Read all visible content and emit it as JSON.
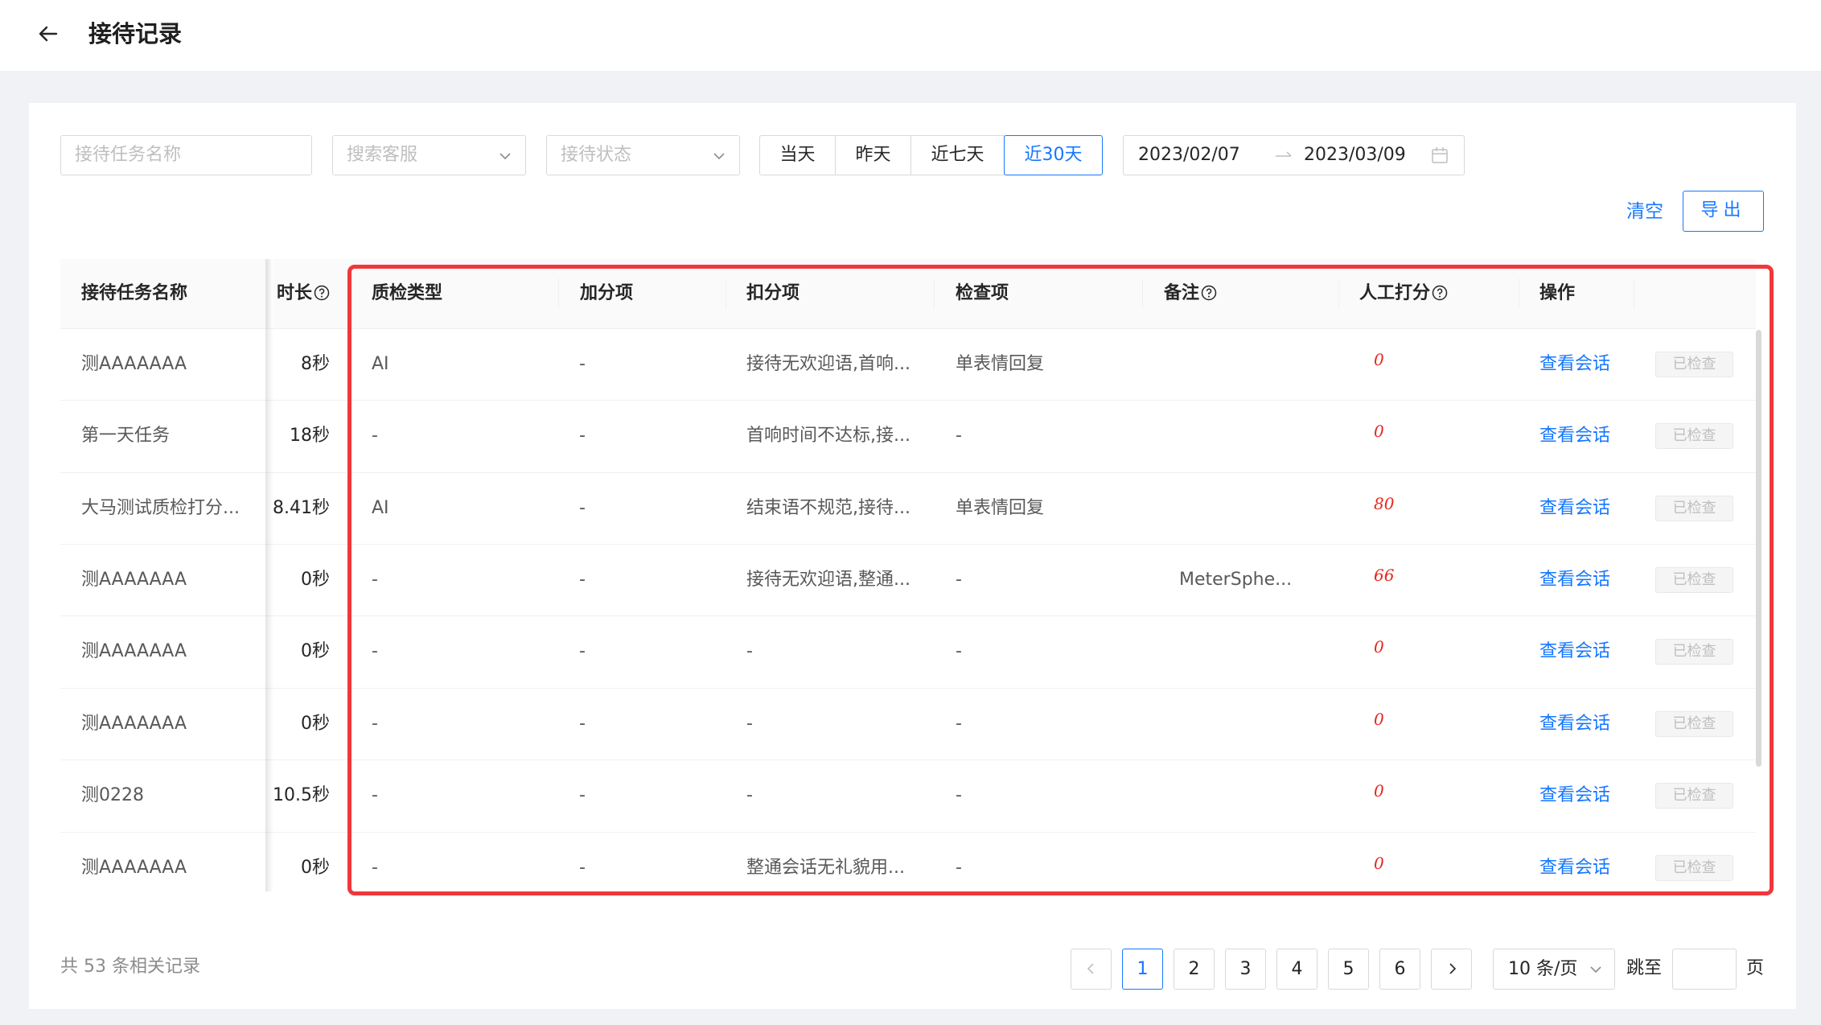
{
  "header": {
    "title": "接待记录"
  },
  "filters": {
    "task_name_placeholder": "接待任务名称",
    "agent_placeholder": "搜索客服",
    "status_placeholder": "接待状态",
    "date_tabs": [
      "当天",
      "昨天",
      "近七天",
      "近30天"
    ],
    "active_tab": "近30天",
    "date_start": "2023/02/07",
    "date_end": "2023/03/09"
  },
  "actions": {
    "clear": "清空",
    "export": "导出"
  },
  "table": {
    "columns": {
      "task_name": "接待任务名称",
      "duration": "时长",
      "qc_type": "质检类型",
      "plus_items": "加分项",
      "minus_items": "扣分项",
      "check_items": "检查项",
      "remarks": "备注",
      "manual_score": "人工打分",
      "operation": "操作"
    },
    "rows": [
      {
        "task_name": "测AAAAAAA",
        "duration": "8秒",
        "qc_type": "AI",
        "plus": "-",
        "minus": "接待无欢迎语,首响...",
        "check": "单表情回复",
        "remark": "",
        "score": "0",
        "action": "查看会话",
        "status": "已检查"
      },
      {
        "task_name": "第一天任务",
        "duration": "18秒",
        "qc_type": "-",
        "plus": "-",
        "minus": "首响时间不达标,接...",
        "check": "-",
        "remark": "",
        "score": "0",
        "action": "查看会话",
        "status": "已检查"
      },
      {
        "task_name": "大马测试质检打分...",
        "duration": "8.41秒",
        "qc_type": "AI",
        "plus": "-",
        "minus": "结束语不规范,接待...",
        "check": "单表情回复",
        "remark": "",
        "score": "80",
        "action": "查看会话",
        "status": "已检查"
      },
      {
        "task_name": "测AAAAAAA",
        "duration": "0秒",
        "qc_type": "-",
        "plus": "-",
        "minus": "接待无欢迎语,整通...",
        "check": "-",
        "remark": "MeterSphe...",
        "score": "66",
        "action": "查看会话",
        "status": "已检查"
      },
      {
        "task_name": "测AAAAAAA",
        "duration": "0秒",
        "qc_type": "-",
        "plus": "-",
        "minus": "-",
        "check": "-",
        "remark": "",
        "score": "0",
        "action": "查看会话",
        "status": "已检查"
      },
      {
        "task_name": "测AAAAAAA",
        "duration": "0秒",
        "qc_type": "-",
        "plus": "-",
        "minus": "-",
        "check": "-",
        "remark": "",
        "score": "0",
        "action": "查看会话",
        "status": "已检查"
      },
      {
        "task_name": "测0228",
        "duration": "10.5秒",
        "qc_type": "-",
        "plus": "-",
        "minus": "-",
        "check": "-",
        "remark": "",
        "score": "0",
        "action": "查看会话",
        "status": "已检查"
      },
      {
        "task_name": "测AAAAAAA",
        "duration": "0秒",
        "qc_type": "-",
        "plus": "-",
        "minus": "整通会话无礼貌用...",
        "check": "-",
        "remark": "",
        "score": "0",
        "action": "查看会话",
        "status": "已检查"
      }
    ]
  },
  "pagination": {
    "total_text": "共 53 条相关记录",
    "pages": [
      "1",
      "2",
      "3",
      "4",
      "5",
      "6"
    ],
    "current": "1",
    "page_size": "10 条/页",
    "jump_label": "跳至",
    "jump_suffix": "页"
  },
  "colors": {
    "accent": "#1677ff",
    "score_red": "#e8271c",
    "highlight_red": "#f0383c"
  }
}
